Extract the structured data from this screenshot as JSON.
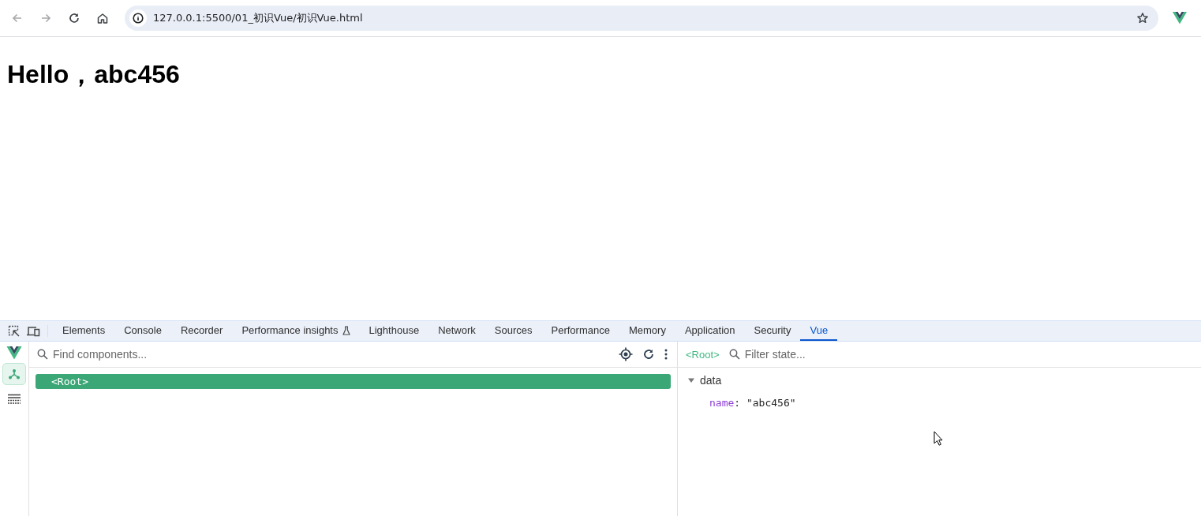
{
  "browser": {
    "nav_buttons": [
      {
        "kind": "back",
        "disabled": true
      },
      {
        "kind": "forward",
        "disabled": true
      },
      {
        "kind": "reload",
        "disabled": false
      },
      {
        "kind": "home",
        "disabled": false
      }
    ],
    "url": "127.0.0.1:5500/01_初识Vue/初识Vue.html"
  },
  "page": {
    "heading": "Hello，abc456"
  },
  "devtools": {
    "tabs": [
      {
        "label": "Elements",
        "selected": false,
        "experimental": false
      },
      {
        "label": "Console",
        "selected": false,
        "experimental": false
      },
      {
        "label": "Recorder",
        "selected": false,
        "experimental": false
      },
      {
        "label": "Performance insights",
        "selected": false,
        "experimental": true
      },
      {
        "label": "Lighthouse",
        "selected": false,
        "experimental": false
      },
      {
        "label": "Network",
        "selected": false,
        "experimental": false
      },
      {
        "label": "Sources",
        "selected": false,
        "experimental": false
      },
      {
        "label": "Performance",
        "selected": false,
        "experimental": false
      },
      {
        "label": "Memory",
        "selected": false,
        "experimental": false
      },
      {
        "label": "Application",
        "selected": false,
        "experimental": false
      },
      {
        "label": "Security",
        "selected": false,
        "experimental": false
      },
      {
        "label": "Vue",
        "selected": true,
        "experimental": false
      }
    ],
    "vue": {
      "sidebar": [
        {
          "kind": "components",
          "selected": true
        },
        {
          "kind": "timeline",
          "selected": false
        }
      ],
      "components_search": {
        "placeholder": "Find components..."
      },
      "tree": [
        {
          "label": "<Root>",
          "selected": true
        }
      ],
      "breadcrumb": "<Root>",
      "state_filter": {
        "placeholder": "Filter state..."
      },
      "sections": [
        {
          "title": "data",
          "expanded": true,
          "entries": [
            {
              "key": "name",
              "separator": ":",
              "value": "\"abc456\""
            }
          ]
        }
      ]
    }
  }
}
